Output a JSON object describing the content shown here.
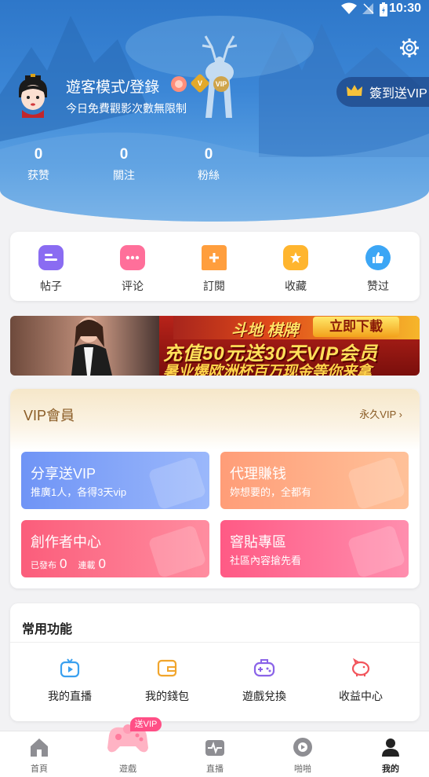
{
  "status_bar": {
    "time": "10:30"
  },
  "profile": {
    "name": "遊客模式/登錄",
    "subtitle": "今日免費觀影次數無限制",
    "checkin_label": "簽到送VIP",
    "badges": [
      "peach-badge",
      "v-badge",
      "vip-badge"
    ]
  },
  "stats": [
    {
      "value": "0",
      "label": "获赞"
    },
    {
      "value": "0",
      "label": "關注"
    },
    {
      "value": "0",
      "label": "粉絲"
    }
  ],
  "quick_actions": [
    {
      "label": "帖子",
      "icon": "post-icon",
      "color": "#8a6cf2"
    },
    {
      "label": "评论",
      "icon": "comment-icon",
      "color": "#ff6f9a"
    },
    {
      "label": "訂閱",
      "icon": "bookmark-icon",
      "color": "#ff9e3d"
    },
    {
      "label": "收藏",
      "icon": "star-icon",
      "color": "#ffb52e"
    },
    {
      "label": "赞过",
      "icon": "thumbs-up-icon",
      "color": "#3ca6f5"
    }
  ],
  "banner": {
    "brand": "斗地 棋牌",
    "download": "立即下載",
    "headline": "充值50元送30天VIP会员",
    "subline": "暑业爆欧洲杯百万现金等你来拿"
  },
  "vip_section": {
    "title": "VIP會員",
    "forever_label": "永久VIP",
    "tiles": {
      "share": {
        "title": "分享送VIP",
        "desc": "推廣1人，各得3天vip"
      },
      "agent": {
        "title": "代理賺钱",
        "desc": "妳想要的，全都有"
      },
      "creator": {
        "title": "創作者中心",
        "published_label": "已發布",
        "published_count": "0",
        "wallet_label": "連載",
        "wallet_count": "0"
      },
      "sticky": {
        "title": "窨貼專區",
        "desc": "社區內容搶先看"
      }
    }
  },
  "common_functions": {
    "title": "常用功能",
    "items": [
      {
        "label": "我的直播",
        "icon": "tv-icon"
      },
      {
        "label": "我的錢包",
        "icon": "wallet-icon"
      },
      {
        "label": "遊戲兌換",
        "icon": "gamepad-icon"
      },
      {
        "label": "收益中心",
        "icon": "piggy-bank-icon"
      }
    ]
  },
  "tab_bar": {
    "send_vip_tag": "送VIP",
    "tabs": [
      {
        "label": "首頁",
        "icon": "home-icon"
      },
      {
        "label": "遊戲",
        "icon": "game-icon"
      },
      {
        "label": "直播",
        "icon": "live-icon"
      },
      {
        "label": "啪啪",
        "icon": "play-icon"
      },
      {
        "label": "我的",
        "icon": "profile-icon"
      }
    ]
  }
}
